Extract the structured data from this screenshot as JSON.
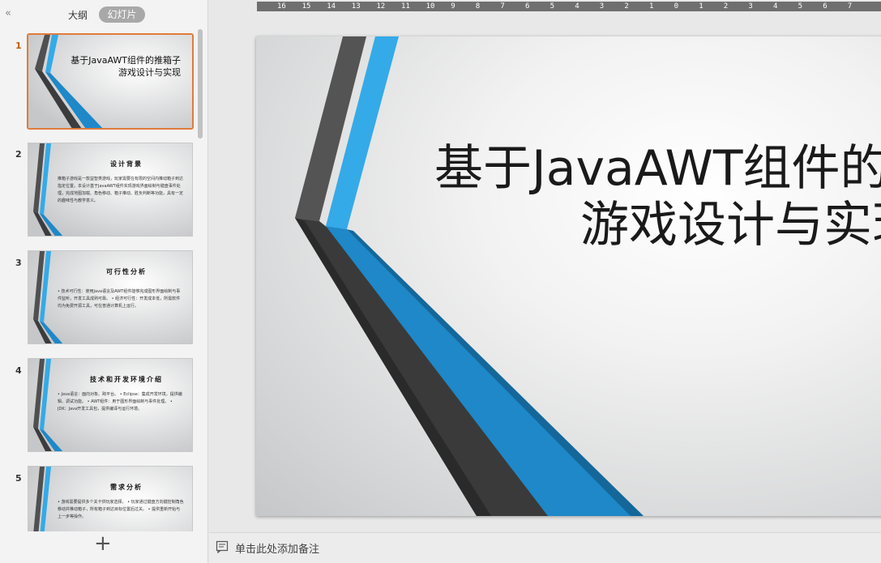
{
  "sidebar": {
    "collapse_glyph": "«",
    "tabs": [
      {
        "label": "大纲",
        "active": false
      },
      {
        "label": "幻灯片",
        "active": true
      }
    ],
    "add_glyph": "+",
    "slides": [
      {
        "number": "1",
        "title": "基于JavaAWT组件的推箱子\n游戏设计与实现"
      },
      {
        "number": "2",
        "heading": "设计背景",
        "body": "推箱子游戏是一款益智类游戏，玩家需要在有限的空间内推动箱子到达指定位置。本设计基于JavaAWT组件实现游戏界面绘制与键盘事件处理，完成地图加载、角色移动、箱子推动、胜负判断等功能，具有一定的趣味性与教学意义。"
      },
      {
        "number": "3",
        "heading": "可行性分析",
        "body": "• 技术可行性：使用Java语言及AWT组件能够完成图形界面绘制与事件监听，开发工具成熟可靠。\n• 经济可行性：开发成本低，所需软件均为免费开源工具，可在普通计算机上运行。"
      },
      {
        "number": "4",
        "heading": "技术和开发环境介绍",
        "body": "• Java语言：面向对象、跨平台。\n• Eclipse：集成开发环境，提供编辑、调试功能。\n• AWT组件：用于图形界面绘制与事件处理。\n• JDK：Java开发工具包，提供编译与运行环境。"
      },
      {
        "number": "5",
        "heading": "需求分析",
        "body": "• 游戏需要提供多个关卡供玩家选择。\n• 玩家通过键盘方向键控制角色移动并推动箱子，所有箱子到达目标位置后过关。\n• 提供重新开始与上一步等操作。"
      }
    ]
  },
  "ruler": {
    "labels": [
      "16",
      "15",
      "14",
      "13",
      "12",
      "11",
      "10",
      "9",
      "8",
      "7",
      "6",
      "5",
      "4",
      "3",
      "2",
      "1",
      "0",
      "1",
      "2",
      "3",
      "4",
      "5",
      "6",
      "7"
    ]
  },
  "slide": {
    "title_line1": "基于JavaAWT组件的推箱子",
    "title_line2": "游戏设计与实现"
  },
  "notes": {
    "placeholder": "单击此处添加备注",
    "icon": "notes-icon"
  },
  "colors": {
    "accent_blue": "#1e88c8",
    "accent_light_blue": "#34aae8",
    "dark_gray": "#444444",
    "selection_orange": "#e07b3c"
  }
}
